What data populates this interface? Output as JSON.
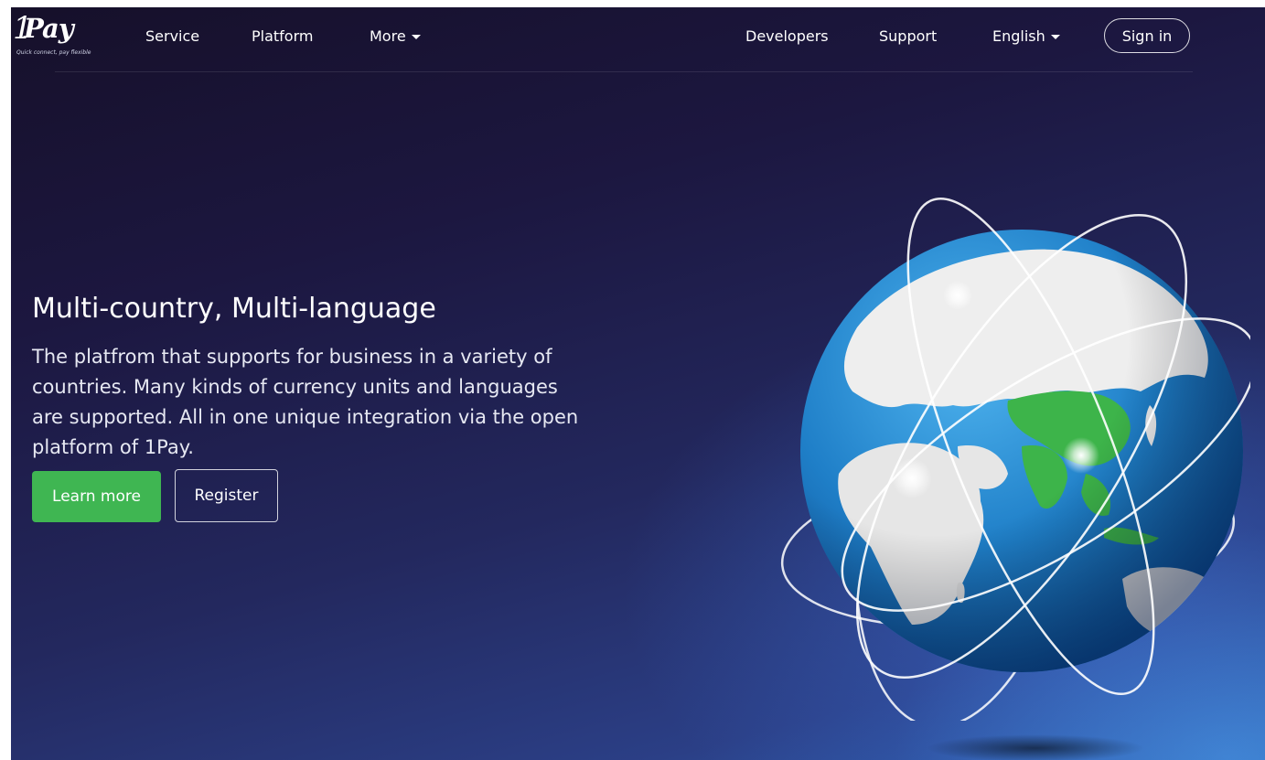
{
  "logo": {
    "mark": "1",
    "word": "Pay",
    "tagline": "Quick connect, pay flexible"
  },
  "nav": {
    "left": [
      {
        "label": "Service"
      },
      {
        "label": "Platform"
      },
      {
        "label": "More"
      }
    ],
    "right": [
      {
        "label": "Developers"
      },
      {
        "label": "Support"
      },
      {
        "label": "English"
      }
    ],
    "sign_in": "Sign in"
  },
  "hero": {
    "title": "Multi-country, Multi-language",
    "description": "The platfrom that supports for business in a variety of countries. Many kinds of currency units and languages are supported. All in one unique integration via the open platform of 1Pay.",
    "learn_more": "Learn more",
    "register": "Register"
  },
  "colors": {
    "accent_green": "#3fb652",
    "ocean": "#1f7fc8",
    "land": "#eeeeee",
    "asia_highlight": "#3db44a"
  },
  "icons": {
    "dropdown": "caret-down-icon",
    "globe": "globe-illustration"
  }
}
